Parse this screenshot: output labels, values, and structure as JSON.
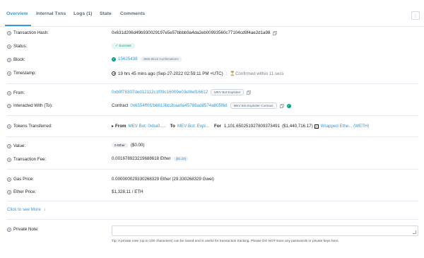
{
  "tabs": [
    {
      "label": "Overview"
    },
    {
      "label": "Internal Txns"
    },
    {
      "label": "Logs (1)"
    },
    {
      "label": "State"
    },
    {
      "label": "Comments"
    }
  ],
  "more_icon": "vertical-ellipsis",
  "fields": {
    "tx_hash": {
      "label": "Transaction Hash:",
      "value": "0x631d206d49b930029197e5e57bbbb9a4da2eb00993560c77104cd9f4ae2d1a98"
    },
    "status": {
      "label": "Status:",
      "value": "Success"
    },
    "block": {
      "label": "Block:",
      "value": "15625438",
      "confirmations": "3866 Block Confirmations"
    },
    "timestamp": {
      "label": "Timestamp:",
      "value": "19 hrs 45 mins ago (Sep-27-2022 02:59:11 PM +UTC)",
      "confirmed": "Confirmed within 11 secs"
    },
    "from": {
      "label": "From:",
      "value": "0xb9f78307ded12112c1f09c16009e03ef4ef16612",
      "tag": "MEV Bot Exploiter"
    },
    "to": {
      "label": "Interacted With (To):",
      "prefix": "Contract",
      "value": "0x6554ff0f2b6613bb2baa9a45788ad8574a805f6d",
      "tag": "MEV Bot Exploiter Contract"
    },
    "tokens": {
      "label": "Tokens Transferred:",
      "from_label": "From",
      "from_value": "MEV Bot: 0xba0.....",
      "to_label": "To",
      "to_value": "MEV Bot: Expl...",
      "for_label": "For",
      "amount": "1,101.650251927809373491",
      "usd": "($1,440,716.17)",
      "token": "Wrapped Ethe... (WETH)"
    },
    "value": {
      "label": "Value:",
      "badge": "0 Ether",
      "usd": "($0.00)"
    },
    "fee": {
      "label": "Transaction Fee:",
      "value": "0.001678923219688618 Ether",
      "usd": "($2.20)"
    },
    "gas": {
      "label": "Gas Price:",
      "value": "0.000000029330268329 Ether (29.330268329 Gwei)"
    },
    "ether_price": {
      "label": "Ether Price:",
      "value": "$1,328.11 / ETH"
    },
    "see_more": "Click to see More",
    "note": {
      "label": "Private Note:",
      "tip": "Tip: A private note (up to 100 characters) can be saved and is useful for transaction tracking. Please DO NOT store any passwords or private keys here."
    }
  },
  "colors": {
    "accent": "#3498db",
    "success": "#00a186",
    "border": "#e7eaf3"
  }
}
